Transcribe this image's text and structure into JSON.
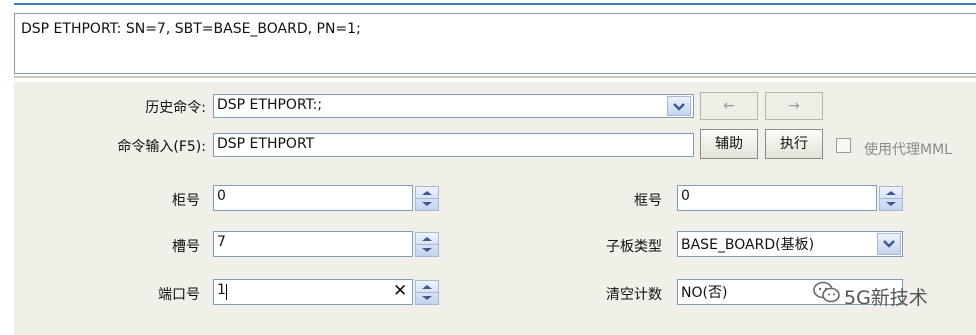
{
  "command_display": "DSP ETHPORT: SN=7, SBT=BASE_BOARD, PN=1;",
  "history": {
    "label": "历史命令:",
    "value": "DSP ETHPORT:;",
    "prev_label": "←",
    "next_label": "→"
  },
  "command_input": {
    "label": "命令输入(F5):",
    "value": "DSP ETHPORT",
    "assist_label": "辅助",
    "execute_label": "执行",
    "proxy_label": "使用代理MML"
  },
  "params": {
    "cabinet": {
      "label": "柜号",
      "value": "0"
    },
    "subrack": {
      "label": "框号",
      "value": "0"
    },
    "slot": {
      "label": "槽号",
      "value": "7"
    },
    "subboard_type": {
      "label": "子板类型",
      "value": "BASE_BOARD(基板)"
    },
    "port": {
      "label": "端口号",
      "value": "1"
    },
    "clear_count": {
      "label": "清空计数",
      "value": "NO(否)"
    }
  },
  "watermark": {
    "text": "5G新技术",
    "icon": "wechat-icon"
  },
  "colors": {
    "panel_bg": "#f0efe8",
    "border": "#7f9db9",
    "accent": "#3a78b8"
  }
}
